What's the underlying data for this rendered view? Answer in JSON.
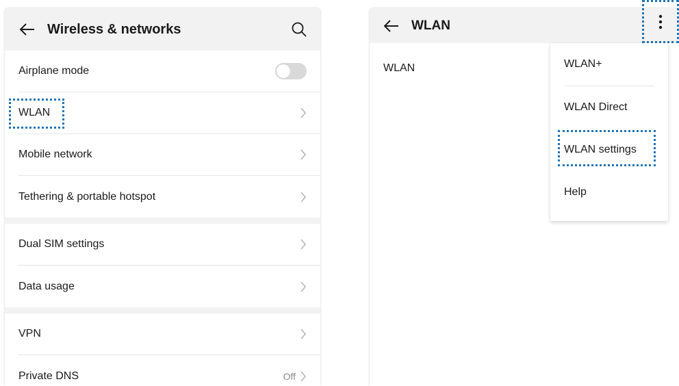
{
  "left": {
    "header": {
      "title": "Wireless & networks",
      "back_icon": "arrow-left-icon",
      "search_icon": "search-icon"
    },
    "groups": [
      [
        {
          "label": "Airplane mode",
          "control": "toggle",
          "toggle_on": false
        },
        {
          "label": "WLAN",
          "value": "",
          "control": "chevron"
        },
        {
          "label": "Mobile network",
          "control": "chevron"
        },
        {
          "label": "Tethering & portable hotspot",
          "control": "chevron"
        }
      ],
      [
        {
          "label": "Dual SIM settings",
          "control": "chevron"
        },
        {
          "label": "Data usage",
          "control": "chevron"
        }
      ],
      [
        {
          "label": "VPN",
          "control": "chevron"
        },
        {
          "label": "Private DNS",
          "value": "Off",
          "control": "chevron"
        }
      ]
    ]
  },
  "right": {
    "header": {
      "title": "WLAN",
      "back_icon": "arrow-left-icon",
      "more_icon": "more-vertical-icon"
    },
    "body_label": "WLAN",
    "menu": [
      "WLAN+",
      "WLAN Direct",
      "WLAN settings",
      "Help"
    ]
  },
  "colors": {
    "highlight": "#1f73b7",
    "header_bg": "#f2f2f2",
    "divider": "#e6e6e6"
  }
}
